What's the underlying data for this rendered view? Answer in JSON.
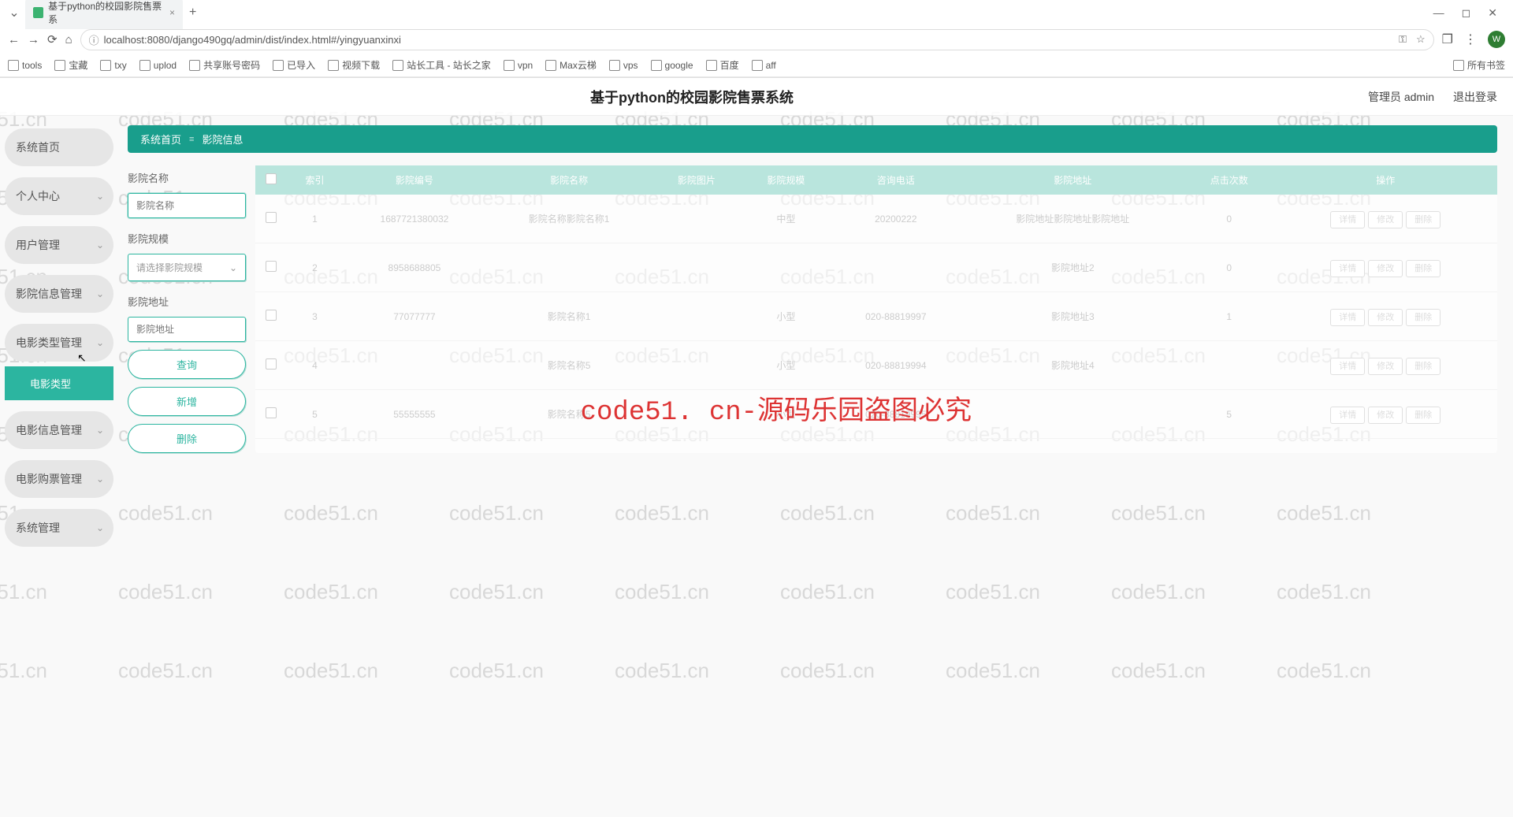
{
  "browser": {
    "tab_title": "基于python的校园影院售票系",
    "close": "×",
    "new_tab": "+",
    "url": "localhost:8080/django490gq/admin/dist/index.html#/yingyuanxinxi",
    "nav": {
      "back": "←",
      "forward": "→",
      "reload": "⟳",
      "home": "⌂",
      "info": "ⓘ"
    },
    "win": {
      "min": "—",
      "max": "◻",
      "close": "✕"
    },
    "avatar": "W",
    "all_bookmarks": "所有书签",
    "bookmarks": [
      {
        "label": "tools"
      },
      {
        "label": "宝藏"
      },
      {
        "label": "txy"
      },
      {
        "label": "uplod",
        "type": "link"
      },
      {
        "label": "共享账号密码"
      },
      {
        "label": "已导入"
      },
      {
        "label": "视频下载"
      },
      {
        "label": "站长工具 - 站长之家"
      },
      {
        "label": "vpn"
      },
      {
        "label": "Max云梯"
      },
      {
        "label": "vps"
      },
      {
        "label": "google"
      },
      {
        "label": "百度"
      },
      {
        "label": "aff"
      }
    ]
  },
  "app": {
    "title": "基于python的校园影院售票系统",
    "user_label": "管理员 admin",
    "logout": "退出登录"
  },
  "sidebar": {
    "items": [
      {
        "label": "系统首页",
        "sub": false
      },
      {
        "label": "个人中心",
        "sub": true
      },
      {
        "label": "用户管理",
        "sub": true
      },
      {
        "label": "影院信息管理",
        "sub": true
      },
      {
        "label": "电影类型管理",
        "sub": true
      },
      {
        "label": "电影信息管理",
        "sub": true
      },
      {
        "label": "电影购票管理",
        "sub": true
      },
      {
        "label": "系统管理",
        "sub": true
      }
    ],
    "sub_active": "电影类型"
  },
  "breadcrumb": {
    "home": "系统首页",
    "sep": "≡",
    "current": "影院信息"
  },
  "filters": {
    "name_label": "影院名称",
    "name_placeholder": "影院名称",
    "scale_label": "影院规模",
    "scale_placeholder": "请选择影院规模",
    "addr_label": "影院地址",
    "addr_placeholder": "影院地址",
    "btn_search": "查询",
    "btn_add": "新增",
    "btn_delete": "删除"
  },
  "table": {
    "headers": [
      "",
      "索引",
      "影院编号",
      "影院名称",
      "影院图片",
      "影院规模",
      "咨询电话",
      "影院地址",
      "点击次数",
      "操作"
    ],
    "ops": {
      "detail": "详情",
      "edit": "修改",
      "del": "删除"
    },
    "rows": [
      {
        "idx": "1",
        "no": "1687721380032",
        "name": "影院名称影院名称1",
        "img": "",
        "scale": "中型",
        "tel": "20200222",
        "addr": "影院地址影院地址影院地址",
        "clicks": "0"
      },
      {
        "idx": "2",
        "no": "8958688805",
        "name": "",
        "img": "",
        "scale": "",
        "tel": "",
        "addr": "影院地址2",
        "clicks": "0"
      },
      {
        "idx": "3",
        "no": "77077777",
        "name": "影院名称1",
        "img": "",
        "scale": "小型",
        "tel": "020-88819997",
        "addr": "影院地址3",
        "clicks": "1"
      },
      {
        "idx": "4",
        "no": "",
        "name": "影院名称5",
        "img": "",
        "scale": "小型",
        "tel": "020-88819994",
        "addr": "影院地址4",
        "clicks": ""
      },
      {
        "idx": "5",
        "no": "55555555",
        "name": "影院名称5",
        "img": "",
        "scale": "小型",
        "tel": "020-88819995",
        "addr": "",
        "clicks": "5"
      }
    ]
  },
  "watermark": {
    "text": "code51.cn",
    "center": "code51. cn-源码乐园盗图必究"
  }
}
